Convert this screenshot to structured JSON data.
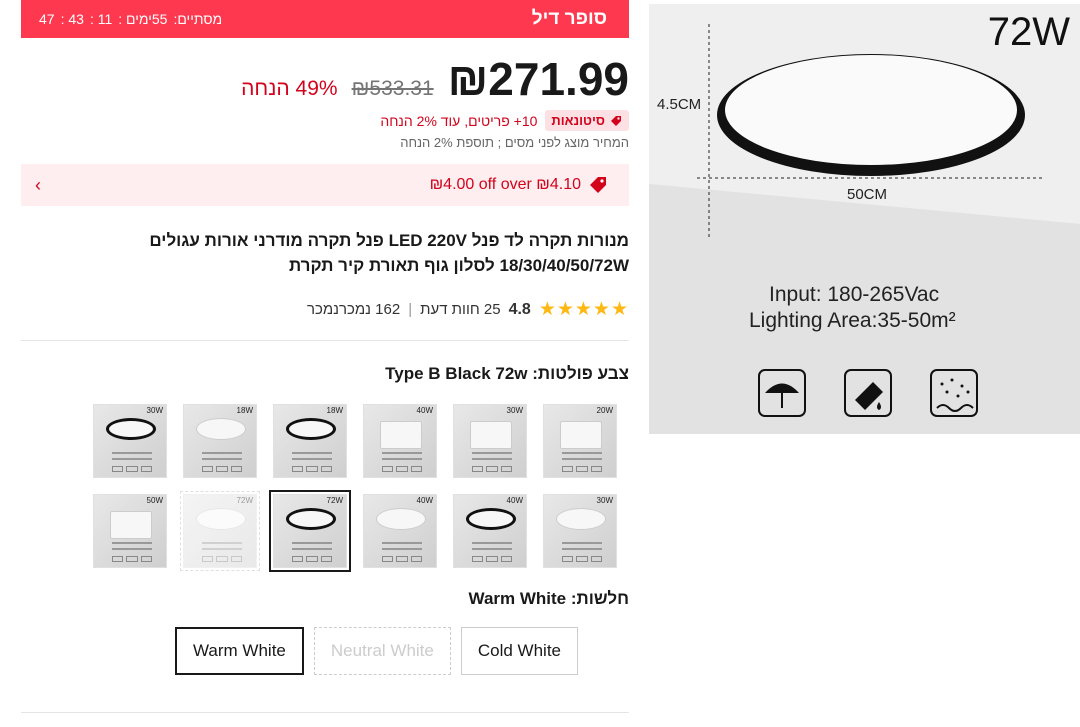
{
  "deal": {
    "title": "סופר דיל",
    "ends_label": "מסתיים:",
    "timer_days": "55ימים :",
    "timer_h": "11 :",
    "timer_m": "43 :",
    "timer_s": "47"
  },
  "price": {
    "current": "₪271.99",
    "original": "₪533.31",
    "discount": "49% הנחה"
  },
  "wholesale": {
    "badge": "סיטונאות",
    "text": "10+ פריטים, עוד 2% הנחה"
  },
  "tax_note": "המחיר מוצג לפני מסים ; תוספת 2% הנחה",
  "coupon": {
    "text": "₪4.00 off over ₪4.10"
  },
  "product": {
    "title": "מנורות תקרה לד פנל LED 220V פנל תקרה מודרני אורות עגולים 18/30/40/50/72W לסלון גוף תאורת קיר תקרת"
  },
  "rating": {
    "score": "4.8",
    "reviews": "25 חוות דעת",
    "sold": "162 נמכרנמכר"
  },
  "color": {
    "label": "צבע פולטות:",
    "selected": "Type B Black 72w"
  },
  "swatches": [
    {
      "watt": "20W",
      "shape": "sq",
      "dark": false,
      "state": ""
    },
    {
      "watt": "30W",
      "shape": "sq",
      "dark": false,
      "state": ""
    },
    {
      "watt": "40W",
      "shape": "sq",
      "dark": false,
      "state": ""
    },
    {
      "watt": "18W",
      "shape": "round",
      "dark": true,
      "state": ""
    },
    {
      "watt": "18W",
      "shape": "round",
      "dark": false,
      "state": ""
    },
    {
      "watt": "30W",
      "shape": "round",
      "dark": true,
      "state": ""
    },
    {
      "watt": "30W",
      "shape": "round",
      "dark": false,
      "state": ""
    },
    {
      "watt": "40W",
      "shape": "round",
      "dark": true,
      "state": ""
    },
    {
      "watt": "40W",
      "shape": "round",
      "dark": false,
      "state": ""
    },
    {
      "watt": "72W",
      "shape": "round",
      "dark": true,
      "state": "sel"
    },
    {
      "watt": "72W",
      "shape": "round",
      "dark": false,
      "state": "dis"
    },
    {
      "watt": "50W",
      "shape": "sq",
      "dark": false,
      "state": ""
    }
  ],
  "lighting": {
    "label": "חלשות:",
    "selected": "Warm White",
    "options": [
      "Cold White",
      "Neutral White",
      "Warm White"
    ]
  },
  "image": {
    "watt": "72W",
    "height_label": "4.5CM",
    "width_label": "50CM",
    "input": "Input: 180-265Vac",
    "area": "Lighting Area:35-50m²"
  },
  "colors": {
    "accent": "#fd384f",
    "price_red": "#d3031c",
    "star": "#fdb813"
  },
  "icons": [
    "fire-tag-icon",
    "price-tag-icon",
    "chevron-right-icon",
    "star-icon",
    "umbrella-icon",
    "water-drop-icon",
    "dust-icon"
  ]
}
